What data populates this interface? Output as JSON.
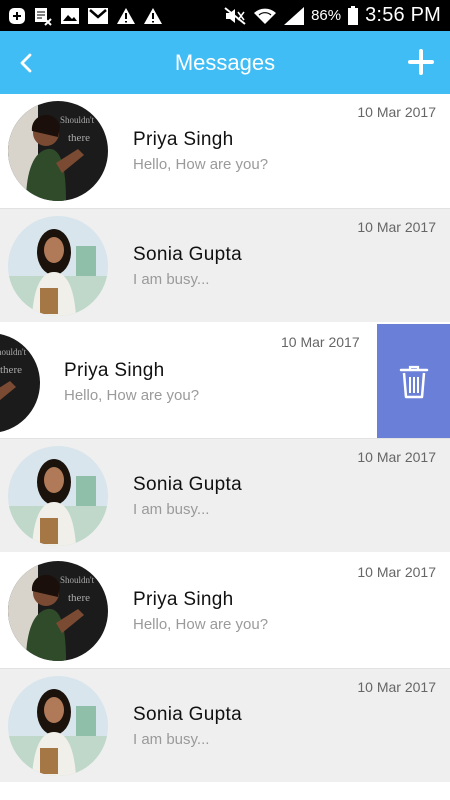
{
  "status_bar": {
    "battery_percent": "86%",
    "time": "3:56 PM",
    "icons_left": [
      "add-box-icon",
      "calendar-x-icon",
      "image-icon",
      "gmail-icon",
      "warning-icon",
      "warning-icon"
    ],
    "icons_right": [
      "mute-icon",
      "wifi-icon",
      "signal-icon",
      "battery-icon"
    ]
  },
  "app_bar": {
    "title": "Messages",
    "back_icon": "chevron-left-icon",
    "add_icon": "plus-icon",
    "color": "#3fbdf4"
  },
  "messages": [
    {
      "name": "Priya Singh",
      "preview": "Hello, How are you?",
      "date": "10 Mar 2017",
      "avatar": "teacher-photo"
    },
    {
      "name": "Sonia Gupta",
      "preview": "I am busy...",
      "date": "10 Mar 2017",
      "avatar": "student-photo"
    },
    {
      "name": "Priya Singh",
      "preview": "Hello, How are you?",
      "date": "10 Mar 2017",
      "avatar": "teacher-photo",
      "swiped": true
    },
    {
      "name": "Sonia Gupta",
      "preview": "I am busy...",
      "date": "10 Mar 2017",
      "avatar": "student-photo"
    },
    {
      "name": "Priya Singh",
      "preview": "Hello, How are you?",
      "date": "10 Mar 2017",
      "avatar": "teacher-photo"
    },
    {
      "name": "Sonia Gupta",
      "preview": "I am busy...",
      "date": "10 Mar 2017",
      "avatar": "student-photo"
    }
  ],
  "delete_action": {
    "icon": "trash-icon",
    "color": "#6a7fd8"
  }
}
